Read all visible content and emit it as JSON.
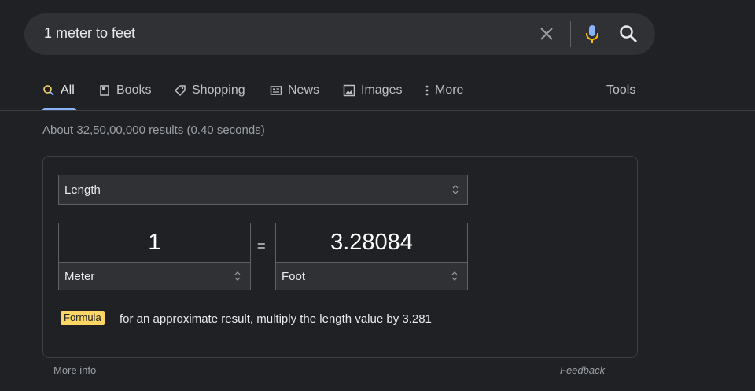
{
  "search": {
    "query": "1 meter to feet"
  },
  "tabs": [
    {
      "label": "All",
      "icon": "search-icon"
    },
    {
      "label": "Books",
      "icon": "book-icon"
    },
    {
      "label": "Shopping",
      "icon": "tag-icon"
    },
    {
      "label": "News",
      "icon": "news-icon"
    },
    {
      "label": "Images",
      "icon": "image-icon"
    },
    {
      "label": "More",
      "icon": "more-vertical-icon"
    }
  ],
  "tools_label": "Tools",
  "result_stats": "About 32,50,00,000 results (0.40 seconds)",
  "converter": {
    "category": "Length",
    "from_value": "1",
    "from_unit": "Meter",
    "equals_sign": "=",
    "to_value": "3.28084",
    "to_unit": "Foot",
    "formula_badge": "Formula",
    "formula_text": "for an approximate result, multiply the length value by 3.281"
  },
  "footer": {
    "more_info": "More info",
    "feedback": "Feedback"
  },
  "colors": {
    "background": "#202124",
    "surface": "#303134",
    "accent_blue": "#8ab4f8",
    "formula_yellow": "#fdd663",
    "mic_yellow": "#fbbc04"
  }
}
